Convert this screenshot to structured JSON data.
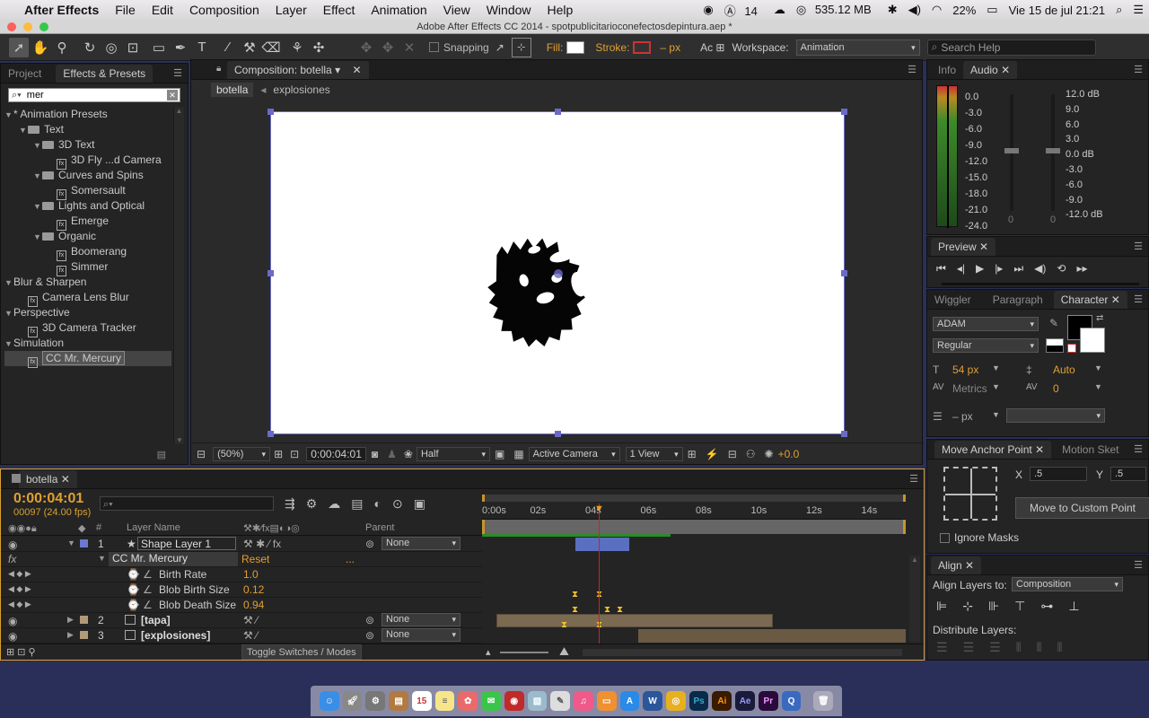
{
  "menubar": {
    "app_name": "After Effects",
    "items": [
      "File",
      "Edit",
      "Composition",
      "Layer",
      "Effect",
      "Animation",
      "View",
      "Window",
      "Help"
    ],
    "status": {
      "adobe_count": "14",
      "memory": "535.12 MB",
      "battery": "22%",
      "datetime": "Vie 15 de jul  21:21"
    }
  },
  "window": {
    "title": "Adobe After Effects CC 2014 - spotpublicitarioconefectosdepintura.aep *"
  },
  "toolbar": {
    "snapping_label": "Snapping",
    "fill_label": "Fill:",
    "stroke_label": "Stroke:",
    "stroke_value": "– px",
    "workspace_label": "Workspace:",
    "workspace_value": "Animation",
    "search_placeholder": "Search Help"
  },
  "left_panel": {
    "tabs": [
      "Project",
      "Effects & Presets"
    ],
    "search_value": "mer",
    "tree": [
      {
        "label": "* Animation Presets",
        "level": 0,
        "type": "root"
      },
      {
        "label": "Text",
        "level": 1,
        "type": "folder"
      },
      {
        "label": "3D Text",
        "level": 2,
        "type": "folder"
      },
      {
        "label": "3D Fly ...d Camera",
        "level": 3,
        "type": "preset"
      },
      {
        "label": "Curves and Spins",
        "level": 2,
        "type": "folder"
      },
      {
        "label": "Somersault",
        "level": 3,
        "type": "preset"
      },
      {
        "label": "Lights and Optical",
        "level": 2,
        "type": "folder"
      },
      {
        "label": "Emerge",
        "level": 3,
        "type": "preset"
      },
      {
        "label": "Organic",
        "level": 2,
        "type": "folder"
      },
      {
        "label": "Boomerang",
        "level": 3,
        "type": "preset"
      },
      {
        "label": "Simmer",
        "level": 3,
        "type": "preset"
      },
      {
        "label": "Blur & Sharpen",
        "level": 0,
        "type": "root"
      },
      {
        "label": "Camera Lens Blur",
        "level": 1,
        "type": "effect"
      },
      {
        "label": "Perspective",
        "level": 0,
        "type": "root"
      },
      {
        "label": "3D Camera Tracker",
        "level": 1,
        "type": "effect"
      },
      {
        "label": "Simulation",
        "level": 0,
        "type": "root"
      },
      {
        "label": "CC Mr. Mercury",
        "level": 1,
        "type": "effect",
        "selected": true
      }
    ]
  },
  "composition": {
    "tab_label": "Composition: botella",
    "breadcrumbs": [
      "botella",
      "explosiones"
    ],
    "zoom": "(50%)",
    "timecode": "0:00:04:01",
    "resolution": "Half",
    "camera": "Active Camera",
    "views": "1 View",
    "exposure": "+0.0"
  },
  "info_panel": {
    "tabs": [
      "Info",
      "Audio"
    ],
    "levels_left": [
      "0.0",
      "-3.0",
      "-6.0",
      "-9.0",
      "-12.0",
      "-15.0",
      "-18.0",
      "-21.0",
      "-24.0"
    ],
    "levels_right": [
      "12.0 dB",
      "9.0",
      "6.0",
      "3.0",
      "0.0 dB",
      "-3.0",
      "-6.0",
      "-9.0",
      "-12.0 dB"
    ],
    "slider_values": [
      "0",
      "0"
    ]
  },
  "preview_panel": {
    "tab": "Preview"
  },
  "character_panel": {
    "tabs": [
      "Wiggler",
      "Paragraph",
      "Character"
    ],
    "font": "ADAM",
    "style": "Regular",
    "size": "54 px",
    "leading": "Auto",
    "kerning": "Metrics",
    "tracking": "0",
    "stroke_width": "– px"
  },
  "anchor_panel": {
    "tabs": [
      "Move Anchor Point",
      "Motion Sket"
    ],
    "x_label": "X",
    "x_value": ".5",
    "y_label": "Y",
    "y_value": ".5",
    "button": "Move to Custom Point",
    "ignore_masks": "Ignore Masks"
  },
  "align_panel": {
    "tab": "Align",
    "align_to_label": "Align Layers to:",
    "align_to_value": "Composition",
    "distribute_label": "Distribute Layers:"
  },
  "timeline": {
    "tab": "botella",
    "timecode": "0:00:04:01",
    "fps": "00097 (24.00 fps)",
    "header": {
      "num": "#",
      "name": "Layer Name",
      "parent": "Parent"
    },
    "ruler": [
      "0:00s",
      "02s",
      "04s",
      "06s",
      "08s",
      "10s",
      "12s",
      "14s"
    ],
    "layers": [
      {
        "num": "1",
        "name": "Shape Layer 1",
        "parent": "None"
      },
      {
        "effect": "CC Mr. Mercury",
        "reset": "Reset",
        "dots": "..."
      },
      {
        "prop": "Birth Rate",
        "value": "1.0"
      },
      {
        "prop": "Blob Birth Size",
        "value": "0.12"
      },
      {
        "prop": "Blob Death Size",
        "value": "0.94"
      },
      {
        "num": "2",
        "name": "[tapa]",
        "parent": "None"
      },
      {
        "num": "3",
        "name": "[explosiones]",
        "parent": "None"
      }
    ],
    "toggle_label": "Toggle Switches / Modes"
  },
  "colors": {
    "accent_orange": "#e0a030",
    "panel_bg": "#242424",
    "layer_bar_blue": "#5a6fc0",
    "layer_bar_tan": "#7a6a52",
    "playhead": "#d42020"
  }
}
